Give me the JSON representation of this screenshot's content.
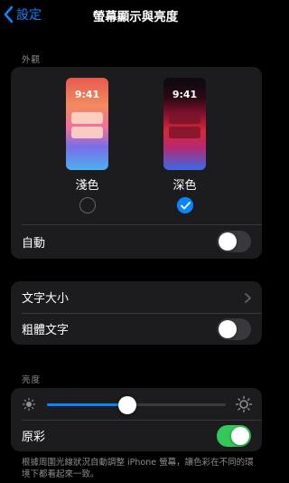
{
  "nav": {
    "back_label": "設定",
    "title": "螢幕顯示與亮度"
  },
  "appearance": {
    "header": "外觀",
    "light": {
      "time": "9:41",
      "label": "淺色",
      "selected": false
    },
    "dark": {
      "time": "9:41",
      "label": "深色",
      "selected": true
    },
    "auto": {
      "label": "自動",
      "on": false
    }
  },
  "text": {
    "size_label": "文字大小",
    "bold": {
      "label": "粗體文字",
      "on": false
    }
  },
  "brightness": {
    "header": "亮度",
    "level": 0.45,
    "true_tone": {
      "label": "原彩",
      "on": true
    },
    "note": "根據周圍光線狀況自動調整 iPhone 螢幕，讓色彩在不同的環境下都看起來一致。"
  },
  "colors": {
    "accent": "#0a84ff",
    "toggle_on": "#34c759"
  }
}
